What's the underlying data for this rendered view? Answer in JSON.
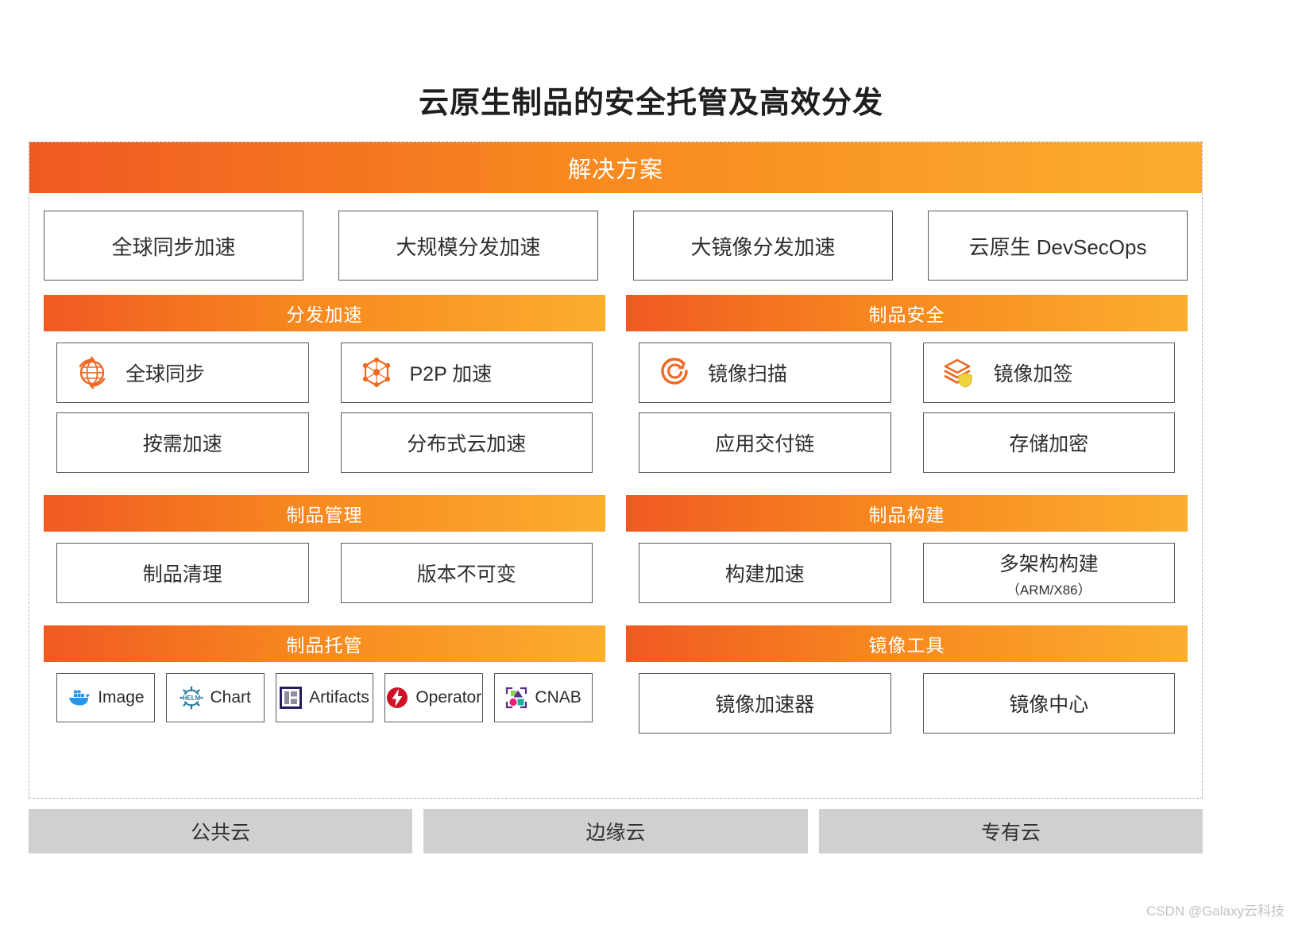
{
  "title": "云原生制品的安全托管及高效分发",
  "solution": {
    "header": "解决方案",
    "items": [
      {
        "label": "全球同步加速"
      },
      {
        "label": "大规模分发加速"
      },
      {
        "label": "大镜像分发加速"
      },
      {
        "label": "云原生 DevSecOps"
      }
    ]
  },
  "left_column": {
    "distribution": {
      "header": "分发加速",
      "items": [
        {
          "label": "全球同步",
          "icon": "globe-sync-icon"
        },
        {
          "label": "P2P 加速",
          "icon": "p2p-network-icon"
        },
        {
          "label": "按需加速",
          "icon": ""
        },
        {
          "label": "分布式云加速",
          "icon": ""
        }
      ]
    },
    "management": {
      "header": "制品管理",
      "items": [
        {
          "label": "制品清理"
        },
        {
          "label": "版本不可变"
        }
      ]
    },
    "hosting": {
      "header": "制品托管",
      "items": [
        {
          "label": "Image",
          "icon": "docker-icon"
        },
        {
          "label": "Chart",
          "icon": "helm-icon"
        },
        {
          "label": "Artifacts",
          "icon": "artifacts-icon"
        },
        {
          "label": "Operator",
          "icon": "operator-icon"
        },
        {
          "label": "CNAB",
          "icon": "cnab-icon"
        }
      ]
    }
  },
  "right_column": {
    "security": {
      "header": "制品安全",
      "items": [
        {
          "label": "镜像扫描",
          "icon": "scan-target-icon"
        },
        {
          "label": "镜像加签",
          "icon": "layers-shield-icon"
        },
        {
          "label": "应用交付链",
          "icon": ""
        },
        {
          "label": "存储加密",
          "icon": ""
        }
      ]
    },
    "build": {
      "header": "制品构建",
      "items": [
        {
          "label": "构建加速",
          "note": ""
        },
        {
          "label": "多架构构建",
          "note": "（ARM/X86）"
        }
      ]
    },
    "tools": {
      "header": "镜像工具",
      "items": [
        {
          "label": "镜像加速器"
        },
        {
          "label": "镜像中心"
        }
      ]
    }
  },
  "clouds": [
    {
      "label": "公共云"
    },
    {
      "label": "边缘云"
    },
    {
      "label": "专有云"
    }
  ],
  "watermark": "CSDN @Galaxy云科技",
  "colors": {
    "gradient_start": "#F05A22",
    "gradient_end": "#FBAE2E",
    "accent_orange": "#EE6A23",
    "docker_blue": "#2496ED",
    "helm_blue": "#277A9F",
    "operator_red": "#CE1126",
    "shield_yellow": "#F2D33C",
    "cloud_gray": "#D0D0D0"
  }
}
